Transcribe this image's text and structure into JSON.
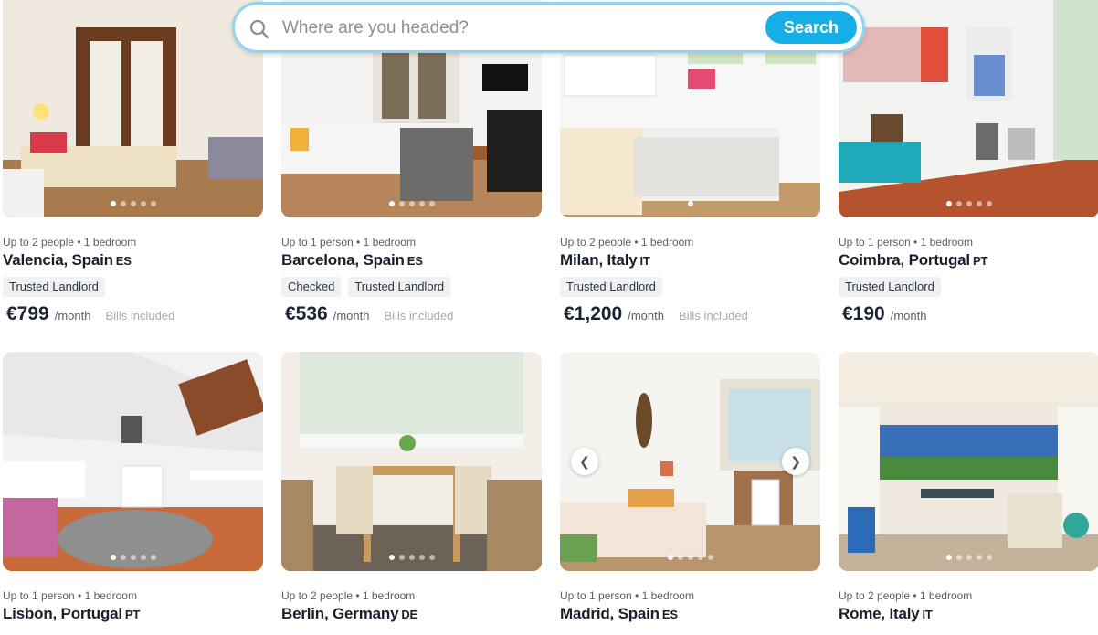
{
  "search": {
    "placeholder": "Where are you headed?",
    "button_label": "Search"
  },
  "listings": [
    {
      "meta": "Up to 2 people • 1 bedroom",
      "city": "Valencia, Spain",
      "country_code": "ES",
      "tags": [
        "Trusted Landlord"
      ],
      "price": "€799",
      "per": "/month",
      "bills": "Bills included",
      "dots": 5,
      "active_dot": 0
    },
    {
      "meta": "Up to 1 person • 1 bedroom",
      "city": "Barcelona, Spain",
      "country_code": "ES",
      "tags": [
        "Checked",
        "Trusted Landlord"
      ],
      "price": "€536",
      "per": "/month",
      "bills": "Bills included",
      "dots": 5,
      "active_dot": 0
    },
    {
      "meta": "Up to 2 people • 1 bedroom",
      "city": "Milan, Italy",
      "country_code": "IT",
      "tags": [
        "Trusted Landlord"
      ],
      "price": "€1,200",
      "per": "/month",
      "bills": "Bills included",
      "dots": 1,
      "active_dot": 0
    },
    {
      "meta": "Up to 1 person • 1 bedroom",
      "city": "Coimbra, Portugal",
      "country_code": "PT",
      "tags": [
        "Trusted Landlord"
      ],
      "price": "€190",
      "per": "/month",
      "bills": "",
      "dots": 5,
      "active_dot": 0
    },
    {
      "meta": "Up to 1 person • 1 bedroom",
      "city": "Lisbon, Portugal",
      "country_code": "PT",
      "tags": [],
      "price": "",
      "per": "",
      "bills": "",
      "dots": 5,
      "active_dot": 0
    },
    {
      "meta": "Up to 2 people • 1 bedroom",
      "city": "Berlin, Germany",
      "country_code": "DE",
      "tags": [],
      "price": "",
      "per": "",
      "bills": "",
      "dots": 5,
      "active_dot": 0
    },
    {
      "meta": "Up to 1 person • 1 bedroom",
      "city": "Madrid, Spain",
      "country_code": "ES",
      "tags": [],
      "price": "",
      "per": "",
      "bills": "",
      "dots": 5,
      "active_dot": 0,
      "arrows": true
    },
    {
      "meta": "Up to 2 people • 1 bedroom",
      "city": "Rome, Italy",
      "country_code": "IT",
      "tags": [],
      "price": "",
      "per": "",
      "bills": "",
      "dots": 5,
      "active_dot": 0
    }
  ],
  "colors": {
    "accent": "#16aee6",
    "search_border": "#8fd4f2",
    "tag_bg": "#eef0f2"
  }
}
